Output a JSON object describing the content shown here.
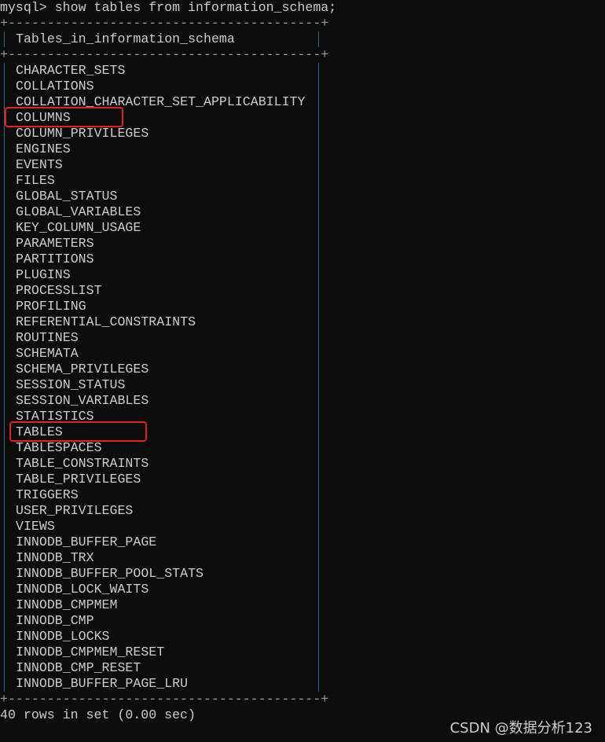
{
  "terminal": {
    "prompt": "mysql>",
    "command": "show tables from information_schema;",
    "border": "+----------------------------------------+",
    "column_header": "Tables_in_information_schema",
    "rows": [
      "CHARACTER_SETS",
      "COLLATIONS",
      "COLLATION_CHARACTER_SET_APPLICABILITY",
      "COLUMNS",
      "COLUMN_PRIVILEGES",
      "ENGINES",
      "EVENTS",
      "FILES",
      "GLOBAL_STATUS",
      "GLOBAL_VARIABLES",
      "KEY_COLUMN_USAGE",
      "PARAMETERS",
      "PARTITIONS",
      "PLUGINS",
      "PROCESSLIST",
      "PROFILING",
      "REFERENTIAL_CONSTRAINTS",
      "ROUTINES",
      "SCHEMATA",
      "SCHEMA_PRIVILEGES",
      "SESSION_STATUS",
      "SESSION_VARIABLES",
      "STATISTICS",
      "TABLES",
      "TABLESPACES",
      "TABLE_CONSTRAINTS",
      "TABLE_PRIVILEGES",
      "TRIGGERS",
      "USER_PRIVILEGES",
      "VIEWS",
      "INNODB_BUFFER_PAGE",
      "INNODB_TRX",
      "INNODB_BUFFER_POOL_STATS",
      "INNODB_LOCK_WAITS",
      "INNODB_CMPMEM",
      "INNODB_CMP",
      "INNODB_LOCKS",
      "INNODB_CMPMEM_RESET",
      "INNODB_CMP_RESET",
      "INNODB_BUFFER_PAGE_LRU"
    ],
    "highlighted_rows": [
      "COLUMNS",
      "TABLES"
    ],
    "result_summary": "40 rows in set (0.00 sec)"
  },
  "watermark": "CSDN @数据分析123",
  "colors": {
    "background": "#0c0c0c",
    "text": "#cccccc",
    "highlight": "#e8201c",
    "table_bar": "#2e6a8c"
  }
}
